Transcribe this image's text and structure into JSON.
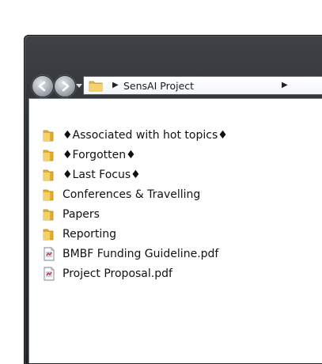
{
  "window": {
    "address_bar": {
      "path_label": "SensAI Project"
    }
  },
  "items": [
    {
      "label": "♦Associated with hot topics♦",
      "type": "folder"
    },
    {
      "label": "♦Forgotten♦",
      "type": "folder"
    },
    {
      "label": "♦Last Focus♦",
      "type": "folder"
    },
    {
      "label": "Conferences & Travelling",
      "type": "folder"
    },
    {
      "label": "Papers",
      "type": "folder"
    },
    {
      "label": "Reporting",
      "type": "folder"
    },
    {
      "label": "BMBF Funding Guideline.pdf",
      "type": "pdf"
    },
    {
      "label": "Project Proposal.pdf",
      "type": "pdf"
    }
  ],
  "icons": {
    "back": "back-arrow-icon",
    "forward": "forward-arrow-icon",
    "folder": "folder-icon",
    "pdf": "pdf-file-icon"
  },
  "colors": {
    "folder": "#f2c44a",
    "frame": "#2b2d30"
  }
}
